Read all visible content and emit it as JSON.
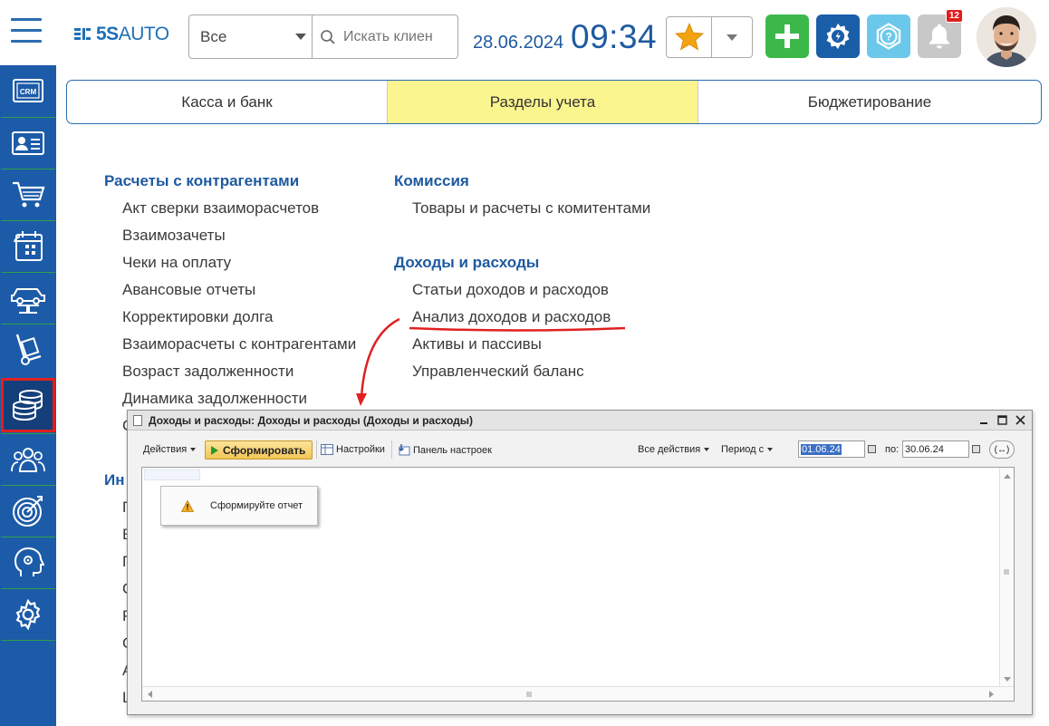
{
  "header": {
    "logo": {
      "bold": "5S",
      "light": "AUTO"
    },
    "search": {
      "scope": "Все",
      "placeholder": "Искать клиен"
    },
    "date": "28.06.2024",
    "time": "09:34",
    "notifications_count": "12",
    "icons": [
      "menu-icon",
      "star-icon",
      "plus-icon",
      "gear-icon",
      "help-icon",
      "bell-icon"
    ]
  },
  "sidebar": {
    "items": [
      {
        "name": "crm",
        "label": "CRM"
      },
      {
        "name": "contacts"
      },
      {
        "name": "cart"
      },
      {
        "name": "calendar"
      },
      {
        "name": "car-lift"
      },
      {
        "name": "tools"
      },
      {
        "name": "finance",
        "active": true
      },
      {
        "name": "team"
      },
      {
        "name": "target"
      },
      {
        "name": "analytics"
      },
      {
        "name": "settings"
      }
    ]
  },
  "tabs": [
    "Касса и банк",
    "Разделы учета",
    "Бюджетирование"
  ],
  "sections": {
    "col1": {
      "title": "Расчеты с контрагентами",
      "links": [
        "Акт сверки взаиморасчетов",
        "Взаимозачеты",
        "Чеки на оплату",
        "Авансовые отчеты",
        "Корректировки долга",
        "Взаиморасчеты с контрагентами",
        "Возраст задолженности",
        "Динамика задолженности"
      ],
      "partial_title": "Ин",
      "partial_letters": [
        "С",
        "П",
        "Е",
        "П",
        "С",
        "Р",
        "С",
        "А",
        "Ц"
      ]
    },
    "col2": {
      "commission_title": "Комиссия",
      "commission_links": [
        "Товары и расчеты с комитентами"
      ],
      "income_title": "Доходы и расходы",
      "income_links": [
        "Статьи доходов и расходов",
        "Анализ доходов и расходов",
        "Активы и пассивы",
        "Управленческий баланс"
      ]
    }
  },
  "popup": {
    "title": "Доходы и расходы: Доходы и расходы (Доходы и расходы)",
    "toolbar": {
      "actions": "Действия",
      "generate": "Сформировать",
      "settings": "Настройки",
      "panel": "Панель настроек",
      "all_actions": "Все действия",
      "period_from": "Период с",
      "date_from": "01.06.24",
      "to_label": "по:",
      "date_to": "30.06.24",
      "period_button": "(↔)"
    },
    "message": "Сформируйте отчет"
  },
  "colors": {
    "brand_blue": "#1c5ba8",
    "active_tab": "#fbf58f",
    "add_green": "#3cb84a",
    "annotation_red": "#e02020"
  }
}
